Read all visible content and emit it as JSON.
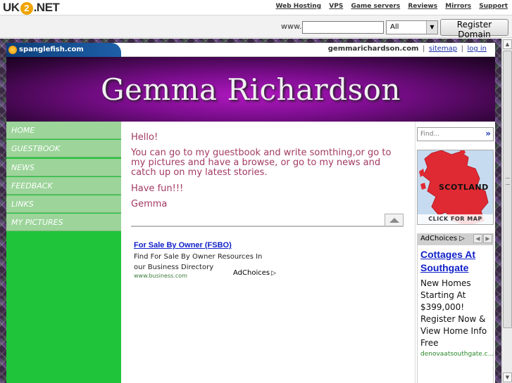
{
  "hostbar": {
    "logo_left": "UK",
    "logo_mid": "2",
    "logo_right": ".NET",
    "links": [
      "Web Hosting",
      "VPS",
      "Game servers",
      "Reviews",
      "Mirrors",
      "Support"
    ]
  },
  "domain_search": {
    "www_label": "www.",
    "input_value": "",
    "tld_selected": "All",
    "register_label": "Register Domain"
  },
  "site": {
    "builder_logo": "spanglefish.com",
    "domain": "gemmarichardson.com",
    "sep": "|",
    "sitemap_label": "sitemap",
    "login_label": "log in",
    "banner_title": "Gemma Richardson"
  },
  "nav": [
    "HOME",
    "GUESTBOOK",
    "NEWS",
    "FEEDBACK",
    "LINKS",
    "MY PICTURES"
  ],
  "content": {
    "hello": "Hello!",
    "body": "You can go to my guestbook and write somthing,or go to my pictures and have a browse, or go to my news and catch up on my latest stories.",
    "fun": "Have fun!!!",
    "sign": "Gemma"
  },
  "ad_main": {
    "title": "For Sale By Owner (FSBO)",
    "desc": "Find For Sale By Owner Resources In our Business Directory",
    "url": "www.business.com",
    "adchoices": "AdChoices"
  },
  "rightcol": {
    "find_placeholder": "Find...",
    "find_go": "»",
    "map_label": "SCOTLAND",
    "map_cta": "CLICK FOR MAP",
    "adchoices": "AdChoices",
    "ad": {
      "title": "Cottages At Southgate",
      "desc": "New Homes Starting At $399,000! Register Now & View Home Info Free",
      "url": "denovaatsouthgate.c..."
    }
  }
}
